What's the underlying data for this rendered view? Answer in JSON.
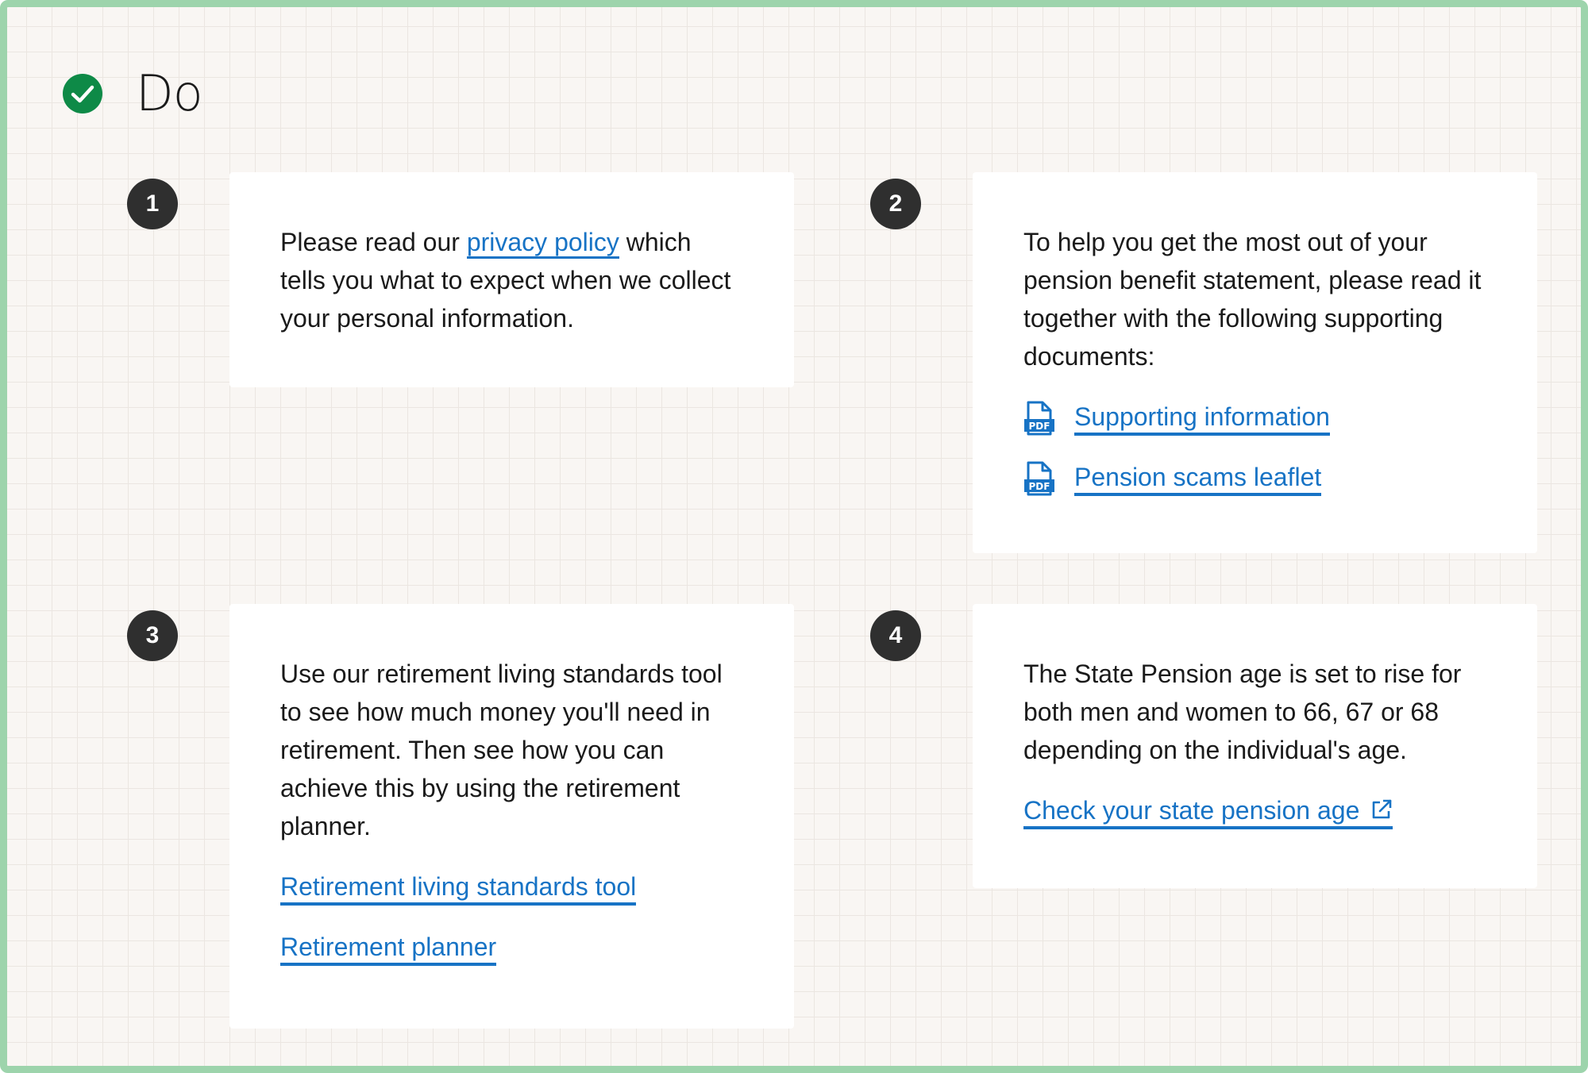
{
  "heading": {
    "label": "Do",
    "icon": "check-circle-icon",
    "icon_color": "#0e8a47"
  },
  "items": [
    {
      "number": "1",
      "text_before": "Please read our ",
      "link_text": "privacy policy",
      "text_after": " which tells you what to expect when we collect your personal information."
    },
    {
      "number": "2",
      "text": "To help you get the most out of your pension benefit statement, please read it together with the following supporting documents:",
      "links": [
        "Supporting information",
        "Pension scams leaflet"
      ],
      "link_icon": "pdf-file-icon"
    },
    {
      "number": "3",
      "text": "Use our retirement living standards tool to see how much money you'll need in retirement. Then see how you can achieve this by using the retirement planner.",
      "links": [
        "Retirement living standards tool",
        "Retirement planner"
      ]
    },
    {
      "number": "4",
      "text": "The State Pension age is set to rise for both men and women to 66, 67 or 68 depending on the individual's age.",
      "link": "Check your state pension age",
      "link_icon": "external-link-icon"
    }
  ],
  "colors": {
    "link": "#1773c5",
    "badge": "#2f2f2f",
    "frame_border": "#9dd4ac",
    "background": "#f9f6f3",
    "card": "#ffffff"
  }
}
